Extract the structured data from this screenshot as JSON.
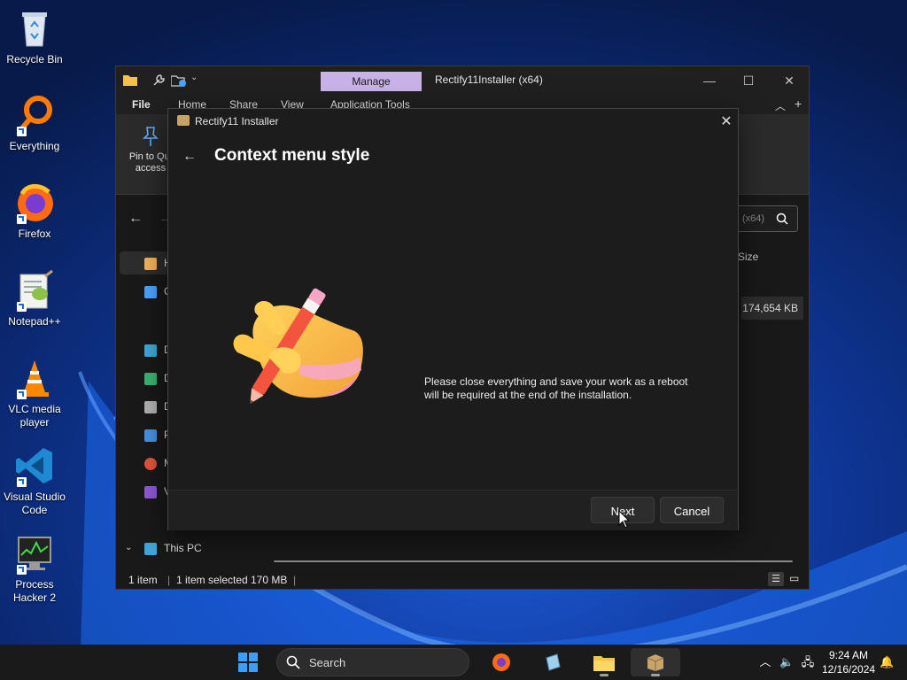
{
  "desktop": {
    "icons": [
      {
        "label": "Recycle Bin",
        "icon": "recycle-bin-icon"
      },
      {
        "label": "Everything",
        "icon": "everything-search-icon"
      },
      {
        "label": "Firefox",
        "icon": "firefox-icon"
      },
      {
        "label": "Notepad++",
        "icon": "notepad-plus-plus-icon"
      },
      {
        "label": "VLC media player",
        "icon": "vlc-cone-icon"
      },
      {
        "label": "Visual Studio Code",
        "icon": "vscode-icon"
      },
      {
        "label": "Process Hacker 2",
        "icon": "process-hacker-icon"
      }
    ]
  },
  "explorer": {
    "manage_tab": "Manage",
    "title": "Rectify11Installer (x64)",
    "menu": [
      "File",
      "Home",
      "Share",
      "View",
      "Application Tools"
    ],
    "ribbon_pin_label": "Pin to Quick access",
    "ribbon_pin_visible": "Pin to Qui",
    "ribbon_pin_visible_2": "access",
    "search_placeholder_partial": "(x64)",
    "nav_home_initial": "H",
    "nav_gallery_initial": "G",
    "nav_desktop_initial": "D",
    "nav_downloads_initial": "D",
    "nav_documents_initial": "D",
    "nav_pictures_initial": "P",
    "nav_music_initial": "M",
    "nav_videos_initial": "V",
    "nav_this_pc": "This PC",
    "column_size": "Size",
    "file_size": "174,654 KB",
    "status": {
      "items": "1 item",
      "selected": "1 item selected",
      "size": "170 MB"
    }
  },
  "installer": {
    "title": "Rectify11 Installer",
    "heading": "Context menu style",
    "message_line1": "Please close everything and save your work as a reboot",
    "message_line2": "will be required at the end of the installation.",
    "next_label": "Next",
    "cancel_label": "Cancel"
  },
  "taskbar": {
    "search_label": "Search",
    "time": "9:24 AM",
    "date": "12/16/2024"
  },
  "colors": {
    "manage_accent": "#c9b2e8",
    "dialog_bg": "#1c1c1c",
    "taskbar_bg": "#1a1a1a"
  }
}
